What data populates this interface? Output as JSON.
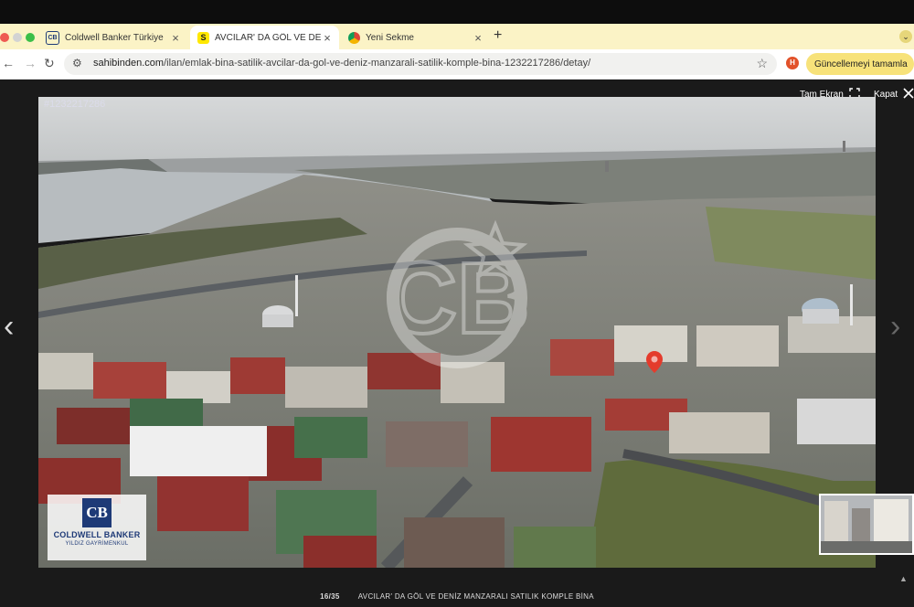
{
  "browser": {
    "tabs": [
      {
        "title": "Coldwell Banker Türkiye",
        "favicon": "coldwell-banker-icon",
        "active": false
      },
      {
        "title": "AVCILAR' DA GÖL VE DENİZ MANZARALI SATILIK KOMPLE BİNA",
        "favicon": "sahibinden-icon",
        "favicon_text": "S",
        "active": true
      },
      {
        "title": "Yeni Sekme",
        "favicon": "chrome-icon",
        "active": false
      }
    ],
    "url_host": "sahibinden.com",
    "url_path": "/ilan/emlak-bina-satilik-avcilar-da-gol-ve-deniz-manzarali-satilik-komple-bina-1232217286/detay/",
    "extension_label": "H",
    "update_button": "Güncellemeyi tamamla",
    "colors": {
      "tab_strip": "#fbf3c6",
      "update_button": "#f7e27a"
    }
  },
  "lightbox": {
    "fullscreen_label": "Tam Ekran",
    "close_label": "Kapat",
    "listing_id": "#1232217286",
    "counter": "16/35",
    "caption": "AVCILAR' DA GÖL VE DENİZ MANZARALI SATILIK KOMPLE BİNA",
    "watermark_brand": "COLDWELL BANKER",
    "watermark_sub": "YILDIZ GAYRİMENKUL",
    "watermark_mark": "CB"
  }
}
